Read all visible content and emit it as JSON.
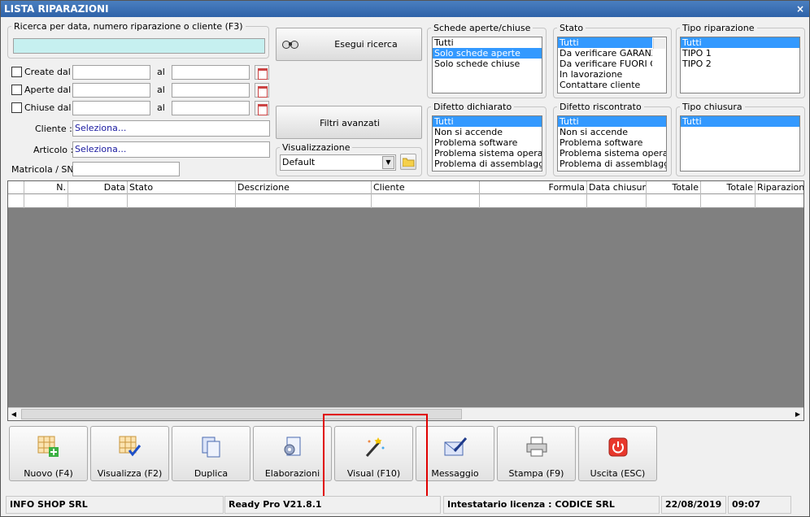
{
  "window": {
    "title": "LISTA RIPARAZIONI",
    "close": "×"
  },
  "search": {
    "legend": "Ricerca per data, numero riparazione o cliente (F3)",
    "value": ""
  },
  "dates": {
    "created": "Create dal",
    "opened": "Aperte dal",
    "closed": "Chiuse dal",
    "al": "al"
  },
  "fields": {
    "cliente_label": "Cliente :",
    "cliente_value": "Seleziona...",
    "articolo_label": "Articolo :",
    "articolo_value": "Seleziona...",
    "matricola_label": "Matricola / SN:"
  },
  "buttons": {
    "search": "Esegui ricerca",
    "filters": "Filtri avanzati"
  },
  "visual": {
    "legend": "Visualizzazione",
    "value": "Default"
  },
  "schede": {
    "legend": "Schede aperte/chiuse",
    "items": [
      "Tutti",
      "Solo schede aperte",
      "Solo schede chiuse"
    ]
  },
  "stato": {
    "legend": "Stato",
    "items": [
      "Tutti",
      "Da verificare GARANZIA",
      "Da verificare FUORI GA",
      "In lavorazione",
      "Contattare cliente"
    ]
  },
  "tipo_rip": {
    "legend": "Tipo riparazione",
    "items": [
      "Tutti",
      "TIPO 1",
      "TIPO 2"
    ]
  },
  "difetto_dich": {
    "legend": "Difetto dichiarato",
    "items": [
      "Tutti",
      "Non si accende",
      "Problema software",
      "Problema sistema operativo",
      "Problema di assemblaggio"
    ]
  },
  "difetto_risc": {
    "legend": "Difetto riscontrato",
    "items": [
      "Tutti",
      "Non si accende",
      "Problema software",
      "Problema sistema operativo",
      "Problema di assemblaggio"
    ]
  },
  "tipo_chius": {
    "legend": "Tipo chiusura",
    "items": [
      "Tutti"
    ]
  },
  "grid": {
    "columns": [
      "N.",
      "Data",
      "Stato",
      "Descrizione",
      "Cliente",
      "Formula",
      "Data chiusura",
      "Totale",
      "Totale",
      "Riparazione"
    ]
  },
  "toolbar": [
    "Nuovo (F4)",
    "Visualizza (F2)",
    "Duplica",
    "Elaborazioni",
    "Visual (F10)",
    "Messaggio",
    "Stampa (F9)",
    "Uscita (ESC)"
  ],
  "status": {
    "company": "INFO SHOP SRL",
    "version": "Ready Pro V21.8.1",
    "license": "Intestatario licenza : CODICE SRL",
    "date": "22/08/2019",
    "time": "09:07"
  }
}
